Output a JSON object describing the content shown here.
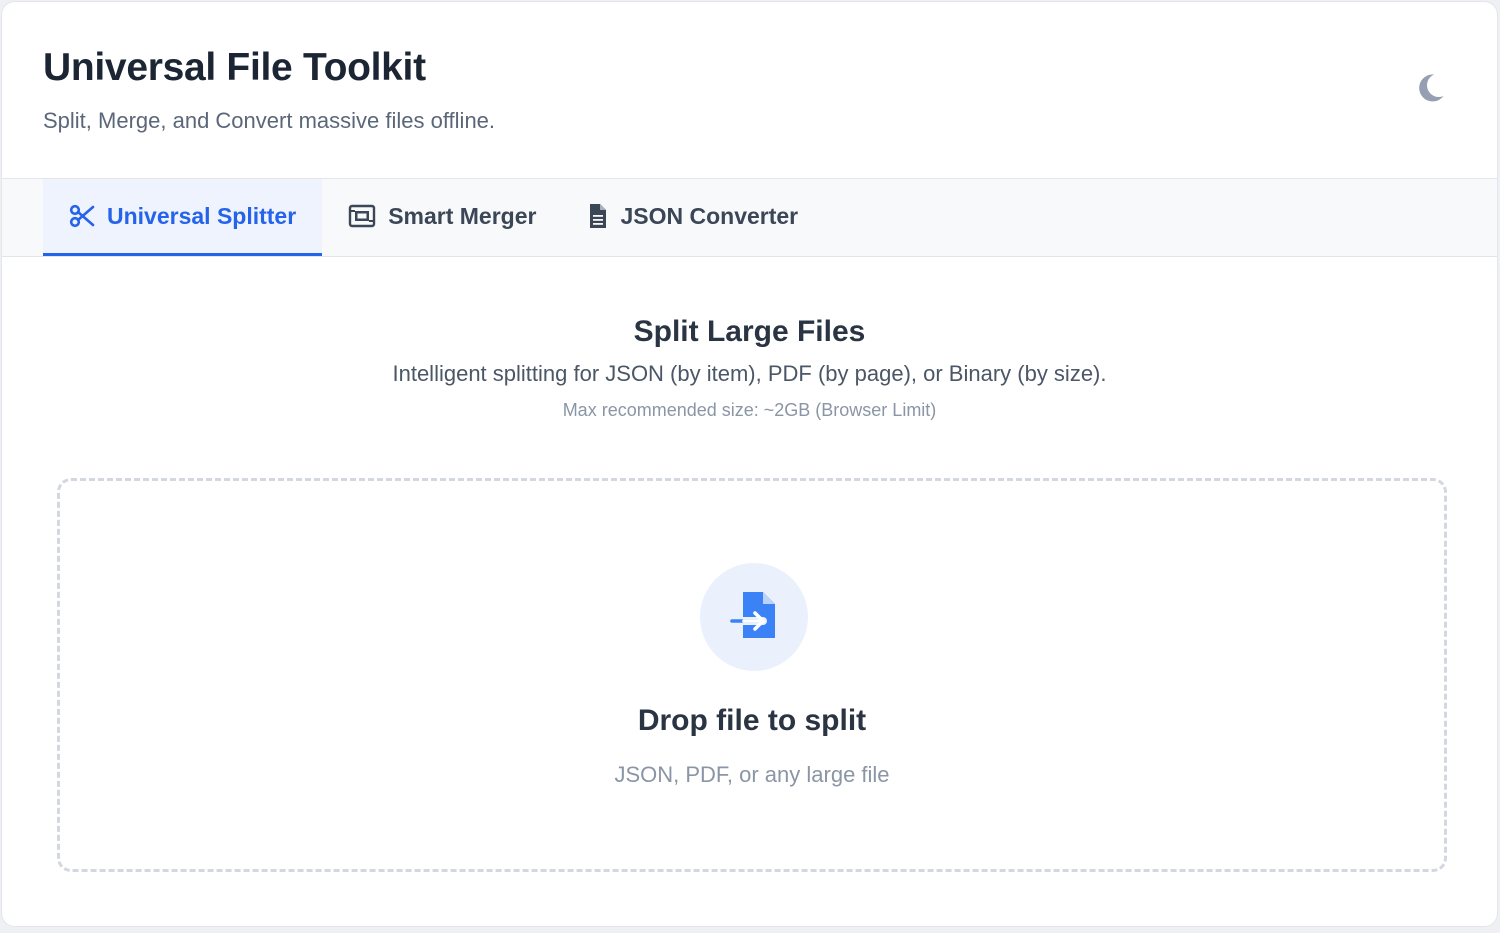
{
  "header": {
    "title": "Universal File Toolkit",
    "subtitle": "Split, Merge, and Convert massive files offline.",
    "theme_icon": "moon-icon"
  },
  "tabs": [
    {
      "label": "Universal Splitter",
      "icon": "scissors-icon",
      "active": true
    },
    {
      "label": "Smart Merger",
      "icon": "merge-frame-icon",
      "active": false
    },
    {
      "label": "JSON Converter",
      "icon": "document-icon",
      "active": false
    }
  ],
  "main": {
    "title": "Split Large Files",
    "description": "Intelligent splitting for JSON (by item), PDF (by page), or Binary (by size).",
    "note": "Max recommended size: ~2GB (Browser Limit)"
  },
  "dropzone": {
    "icon": "file-import-icon",
    "title": "Drop file to split",
    "hint": "JSON, PDF, or any large file"
  },
  "colors": {
    "accent": "#2563eb",
    "title_text": "#1b2533",
    "muted_text": "#8a95a5",
    "tab_active_bg": "#eef3fd",
    "icon_circle_bg": "#eaf1fd"
  }
}
